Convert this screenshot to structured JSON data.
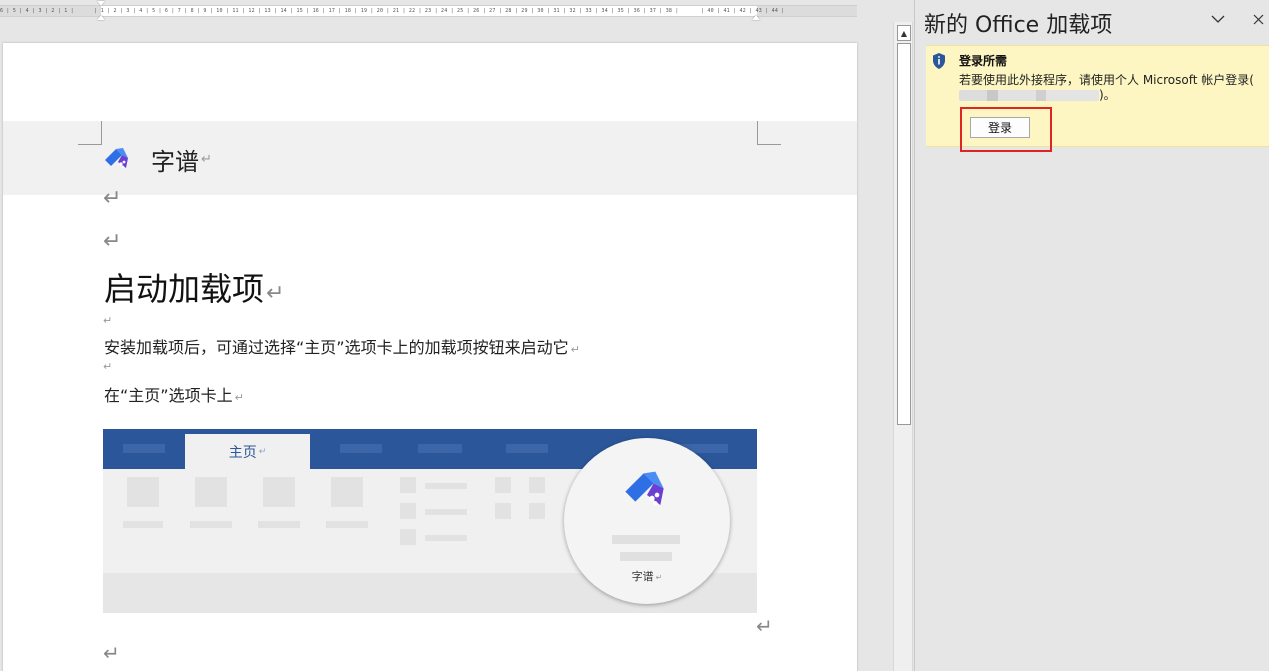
{
  "ruler": {
    "left_numbers": "6 | 5 | 4 | 3 | 2 | 1 |",
    "main_numbers": "| 1 | 2 | 3 | 4 | 5 | 6 | 7 | 8 | 9 | 10 | 11 | 12 | 13 | 14 | 15 | 16 | 17 | 18 | 19 | 20 | 21 | 22 | 23 | 24 | 25 | 26 | 27 | 28 | 29 | 30 | 31 | 32 | 33 | 34 | 35 | 36 | 37 | 38 |",
    "right_numbers": "| 40 | 41 | 42 | 43 | 44 |"
  },
  "document": {
    "logo_text": "字谱",
    "heading": "启动加载项",
    "para1": "安装加载项后，可通过选择“主页”选项卡上的加载项按钮来启动它",
    "para2": "在“主页”选项卡上",
    "paragraph_mark": "↵",
    "illustration": {
      "home_tab_label": "主页",
      "circle_label": "字谱"
    }
  },
  "pane": {
    "title": "新的 Office 加载项",
    "collapse_icon": "chevron-down-icon",
    "close_icon": "close-icon",
    "notice": {
      "title": "登录所需",
      "message_part1": "若要使用此外接程序，请使用个人 Microsoft 帐户登录(",
      "message_part2": ")。",
      "button_label": "登录"
    }
  },
  "colors": {
    "ribbon_blue": "#2b579a",
    "notice_bg": "#fdf6c3",
    "highlight_red": "#e02424",
    "shield_blue": "#2b579a"
  }
}
